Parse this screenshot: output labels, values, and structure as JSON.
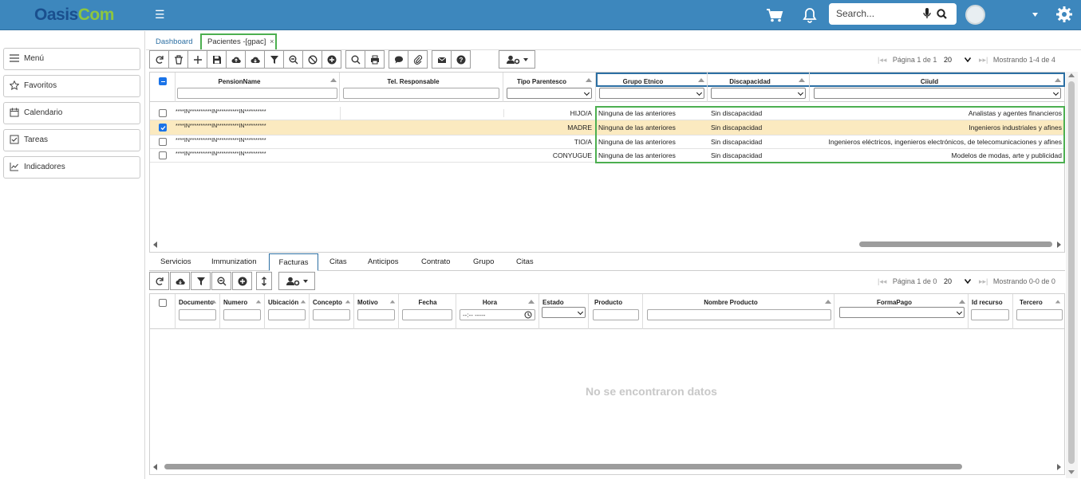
{
  "app": {
    "logo_part1": "Oasis",
    "logo_part2": "Com",
    "search_placeholder": "Search..."
  },
  "sidebar": {
    "items": [
      {
        "label": "Menú",
        "icon": "menu-icon"
      },
      {
        "label": "Favoritos",
        "icon": "star-icon"
      },
      {
        "label": "Calendario",
        "icon": "calendar-icon"
      },
      {
        "label": "Tareas",
        "icon": "task-icon"
      },
      {
        "label": "Indicadores",
        "icon": "chart-icon"
      }
    ]
  },
  "tabs": {
    "dashboard": "Dashboard",
    "active": "Pacientes -[gpac]",
    "close": "×"
  },
  "toolbar": {
    "page_label": "Página 1 de 1",
    "page_size": "20",
    "showing": "Mostrando 1-4 de 4"
  },
  "main_grid": {
    "columns": [
      "PensionName",
      "Tel. Responsable",
      "Tipo Parentesco",
      "Grupo Etnico",
      "Discapacidad",
      "Ciiuld"
    ],
    "rows": [
      {
        "pension": "****IN**********IN**********IN**********",
        "tel": "",
        "tipo": "HIJO/A",
        "grupo": "Ninguna de las anteriores",
        "disc": "Sin discapacidad",
        "ciiu": "Analistas y agentes financieros",
        "checked": false
      },
      {
        "pension": "****IN**********IN**********IN**********",
        "tel": "",
        "tipo": "MADRE",
        "grupo": "Ninguna de las anteriores",
        "disc": "Sin discapacidad",
        "ciiu": "Ingenieros industriales y afines",
        "checked": true
      },
      {
        "pension": "****IN**********IN**********IN**********",
        "tel": "",
        "tipo": "TIO/A",
        "grupo": "Ninguna de las anteriores",
        "disc": "Sin discapacidad",
        "ciiu": "Ingenieros eléctricos, ingenieros electrónicos, de telecomunicaciones y afines",
        "checked": false
      },
      {
        "pension": "****IN**********IN**********IN**********",
        "tel": "",
        "tipo": "CONYUGUE",
        "grupo": "Ninguna de las anteriores",
        "disc": "Sin discapacidad",
        "ciiu": "Modelos de modas, arte y publicidad",
        "checked": false
      }
    ]
  },
  "bottom_tabs": [
    "Servicios",
    "Immunization",
    "Facturas",
    "Citas",
    "Anticipos",
    "Contrato",
    "Grupo",
    "Citas"
  ],
  "bottom_toolbar": {
    "page_label": "Página 1 de 0",
    "page_size": "20",
    "showing": "Mostrando 0-0 de 0"
  },
  "bottom_grid": {
    "columns": [
      "Documento",
      "Numero",
      "Ubicación",
      "Concepto",
      "Motivo",
      "Fecha",
      "Hora",
      "Estado",
      "Producto",
      "Nombre Producto",
      "FormaPago",
      "Id recurso",
      "Tercero"
    ],
    "time_placeholder": "--:-- -----",
    "empty": "No se encontraron datos"
  },
  "colors": {
    "topbar": "#3d87bd",
    "accent_green": "#4caf50",
    "accent_blue": "#2c6fa3",
    "selected_row": "#fbeac0"
  }
}
